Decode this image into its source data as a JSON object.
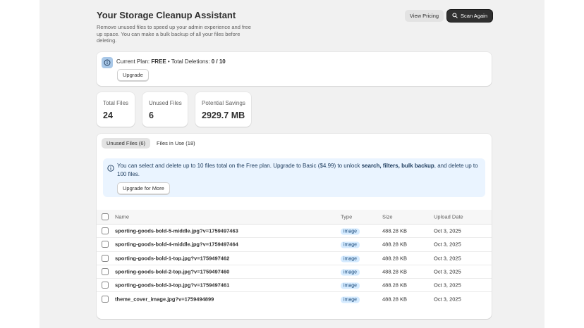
{
  "header": {
    "title": "Your Storage Cleanup Assistant",
    "subtitle": "Remove unused files to speed up your admin experience and free up space. You can make a bulk backup of all your files before deleting.",
    "view_pricing_label": "View Pricing",
    "scan_again_label": "Scan Again"
  },
  "plan": {
    "prefix": "Current Plan: ",
    "plan_name": "FREE",
    "separator": " • Total Deletions: ",
    "deletions": "0 / 10",
    "upgrade_label": "Upgrade"
  },
  "stats": [
    {
      "label": "Total Files",
      "value": "24"
    },
    {
      "label": "Unused Files",
      "value": "6"
    },
    {
      "label": "Potential Savings",
      "value": "2929.7 MB"
    }
  ],
  "tabs": [
    {
      "label": "Unused Files (6)",
      "active": true
    },
    {
      "label": "Files in Use (18)",
      "active": false
    }
  ],
  "banner": {
    "text_1": "You can select and delete up to 10 files total on the Free plan. Upgrade to Basic ($4.99) to unlock ",
    "text_bold": "search, filters, bulk backup",
    "text_2": ", and delete up to 100 files.",
    "button_label": "Upgrade for More"
  },
  "table": {
    "columns": [
      "Name",
      "Type",
      "Size",
      "Upload Date"
    ],
    "rows": [
      {
        "name": "sporting-goods-bold-5-middle.jpg?v=1759497463",
        "type": "image",
        "size": "488.28 KB",
        "date": "Oct 3, 2025"
      },
      {
        "name": "sporting-goods-bold-4-middle.jpg?v=1759497464",
        "type": "image",
        "size": "488.28 KB",
        "date": "Oct 3, 2025"
      },
      {
        "name": "sporting-goods-bold-1-top.jpg?v=1759497462",
        "type": "image",
        "size": "488.28 KB",
        "date": "Oct 3, 2025"
      },
      {
        "name": "sporting-goods-bold-2-top.jpg?v=1759497460",
        "type": "image",
        "size": "488.28 KB",
        "date": "Oct 3, 2025"
      },
      {
        "name": "sporting-goods-bold-3-top.jpg?v=1759497461",
        "type": "image",
        "size": "488.28 KB",
        "date": "Oct 3, 2025"
      },
      {
        "name": "theme_cover_image.jpg?v=1759494899",
        "type": "image",
        "size": "488.28 KB",
        "date": "Oct 3, 2025"
      }
    ]
  },
  "colors": {
    "accent_dark": "#303030",
    "banner_bg": "#eaf4ff",
    "badge_bg": "#d5ebff",
    "plan_icon_bg": "#a9c8e8"
  },
  "icons": {
    "plan": "info-icon",
    "scan": "search-icon",
    "banner": "info-icon"
  }
}
